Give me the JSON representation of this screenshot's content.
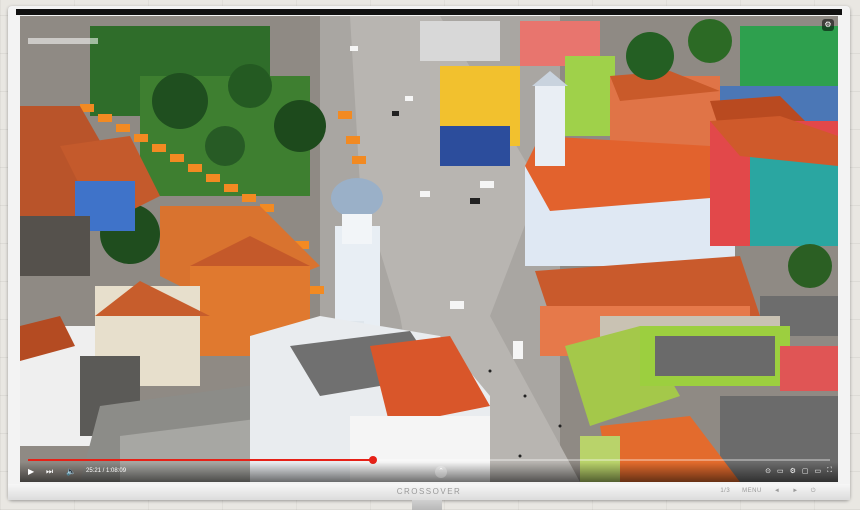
{
  "display": {
    "brand": "CROSSOVER",
    "menu_label": "MENU",
    "menu_hint": "1/3",
    "left_arrow": "◄",
    "right_arrow": "►",
    "power_icon": "power-icon"
  },
  "player": {
    "time_text": "25:21 / 1:08:09",
    "progress": 0.43,
    "accent": "#e62117",
    "play_icon": "play-icon",
    "next_icon": "next-icon",
    "volume_icon": "volume-icon",
    "chevron_icon": "chevron-up-icon",
    "right_icons": [
      "autoplay-icon",
      "subtitles-icon",
      "settings-icon",
      "miniplayer-icon",
      "theater-icon",
      "fullscreen-icon"
    ],
    "right_glyphs": [
      "⊙",
      "▭",
      "⚙",
      "▢",
      "▭",
      "⛶"
    ]
  }
}
